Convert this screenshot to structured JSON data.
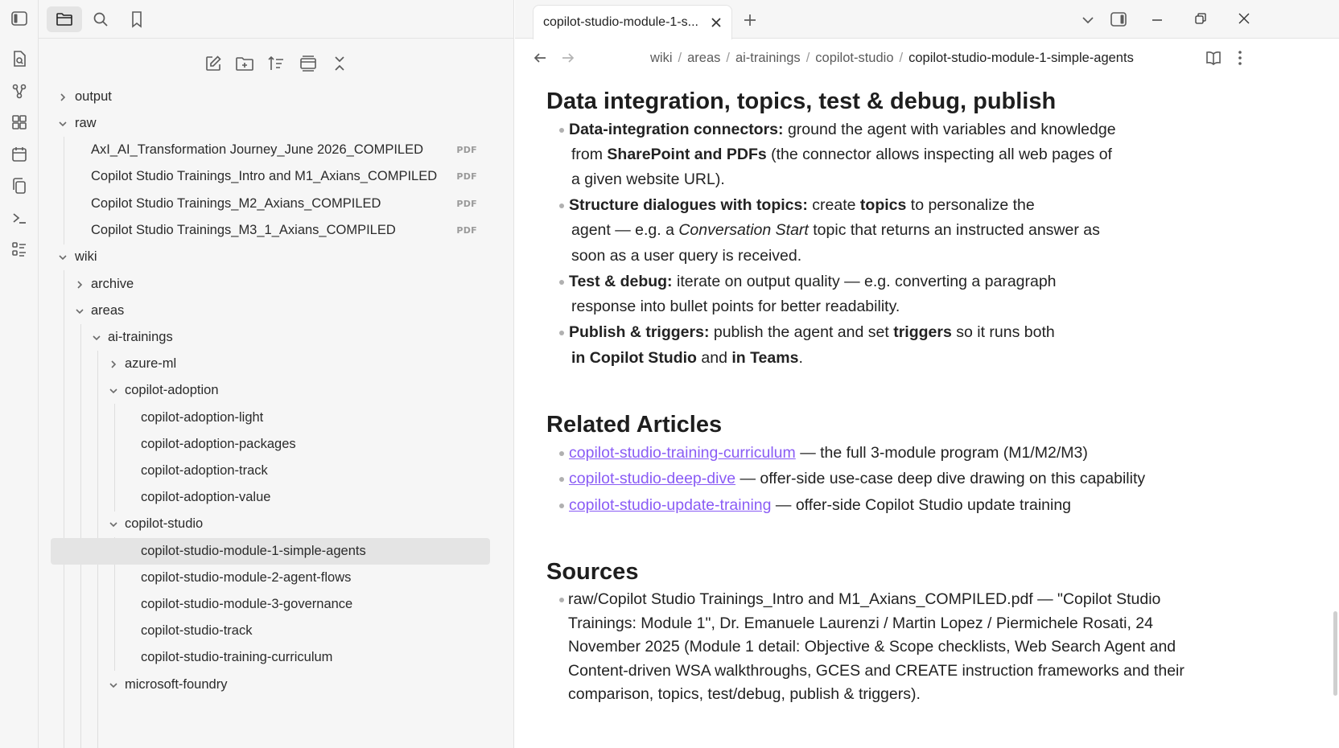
{
  "tabs": {
    "active_title": "copilot-studio-module-1-s..."
  },
  "breadcrumb": {
    "items": [
      "wiki",
      "areas",
      "ai-trainings",
      "copilot-studio"
    ],
    "current": "copilot-studio-module-1-simple-agents",
    "sep": "/"
  },
  "tree": {
    "output": "output",
    "raw": "raw",
    "raw_files": [
      "AxI_AI_Transformation Journey_June 2026_COMPILED",
      "Copilot Studio Trainings_Intro and M1_Axians_COMPILED",
      "Copilot Studio Trainings_M2_Axians_COMPILED",
      "Copilot Studio Trainings_M3_1_Axians_COMPILED"
    ],
    "pdf_badge": "PDF",
    "wiki": "wiki",
    "archive": "archive",
    "areas": "areas",
    "ai_trainings": "ai-trainings",
    "azure_ml": "azure-ml",
    "copilot_adoption": "copilot-adoption",
    "copilot_adoption_items": [
      "copilot-adoption-light",
      "copilot-adoption-packages",
      "copilot-adoption-track",
      "copilot-adoption-value"
    ],
    "copilot_studio": "copilot-studio",
    "copilot_studio_items": [
      "copilot-studio-module-1-simple-agents",
      "copilot-studio-module-2-agent-flows",
      "copilot-studio-module-3-governance",
      "copilot-studio-track",
      "copilot-studio-training-curriculum"
    ],
    "microsoft_foundry": "microsoft-foundry"
  },
  "doc": {
    "h_data": "Data integration, topics, test & debug, publish",
    "b1_bold": "Data-integration connectors:",
    "b1_rest": " ground the agent with variables and knowledge",
    "b1_l2_pre": "from ",
    "b1_l2_bold": "SharePoint and PDFs",
    "b1_l2_rest": " (the connector allows inspecting all web pages of",
    "b1_l3": "a given website URL).",
    "b2_bold": "Structure dialogues with topics:",
    "b2_mid": " create ",
    "b2_bold2": "topics",
    "b2_rest": " to personalize the",
    "b2_l2_pre": "agent — e.g. a ",
    "b2_l2_em": "Conversation Start",
    "b2_l2_rest": " topic that returns an instructed answer as",
    "b2_l3": "soon as a user query is received.",
    "b3_bold": "Test & debug:",
    "b3_rest": " iterate on output quality — e.g. converting a paragraph",
    "b3_l2": "response into bullet points for better readability.",
    "b4_bold": "Publish & triggers:",
    "b4_mid": " publish the agent and set ",
    "b4_bold2": "triggers",
    "b4_rest": " so it runs both",
    "b4_l2_bold": "in Copilot Studio",
    "b4_l2_mid": " and ",
    "b4_l2_bold2": "in Teams",
    "b4_l2_end": ".",
    "h_related": "Related Articles",
    "related": [
      {
        "link": "copilot-studio-training-curriculum",
        "desc": " — the full 3-module program (M1/M2/M3)"
      },
      {
        "link": "copilot-studio-deep-dive",
        "desc": " — offer-side use-case deep dive drawing on this capability"
      },
      {
        "link": "copilot-studio-update-training",
        "desc": " — offer-side Copilot Studio update training"
      }
    ],
    "h_sources": "Sources",
    "source_lines": [
      "raw/Copilot Studio Trainings_Intro and M1_Axians_COMPILED.pdf — \"Copilot Studio",
      "Trainings: Module 1\", Dr. Emanuele Laurenzi / Martin Lopez / Piermichele Rosati, 24",
      "November 2025 (Module 1 detail: Objective & Scope checklists, Web Search Agent and",
      "Content-driven WSA walkthroughs, GCES and CREATE instruction frameworks and their",
      "comparison, topics, test/debug, publish & triggers)."
    ]
  },
  "colors": {
    "link": "#8a5cf5",
    "sidebar_bg": "#f6f6f6",
    "selected": "#e4e4e4"
  }
}
